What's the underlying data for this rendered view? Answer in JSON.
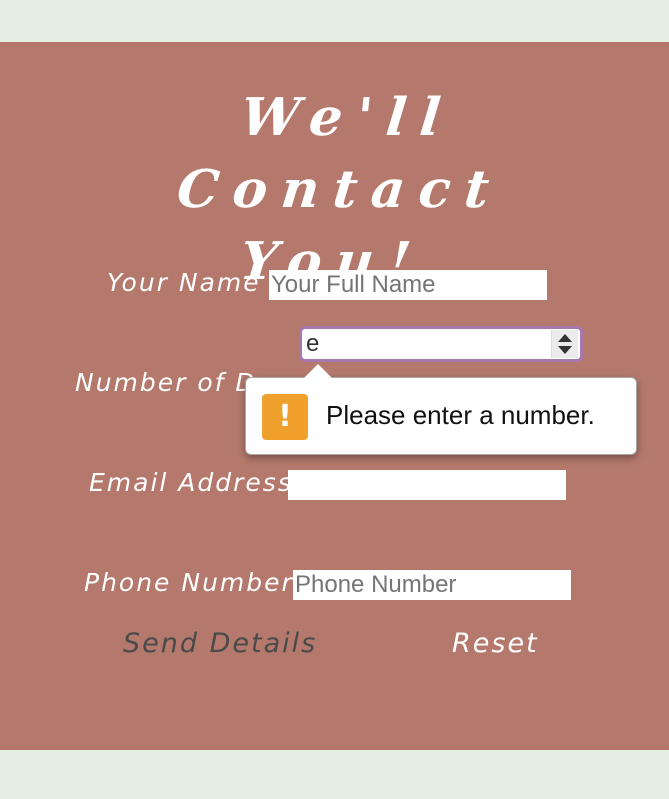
{
  "heading": {
    "line1": "We'll Contact",
    "line2": "You!"
  },
  "form": {
    "name": {
      "label": "Your Name",
      "placeholder": "Your Full Name",
      "value": ""
    },
    "dogs": {
      "label": "Number of Dogs",
      "value": "e"
    },
    "email": {
      "label": "Email Address",
      "placeholder": "",
      "value": ""
    },
    "phone": {
      "label": "Phone Number",
      "placeholder": "Phone Number",
      "value": ""
    }
  },
  "validation": {
    "message": "Please enter a number.",
    "icon": "warning-icon",
    "icon_glyph": "!"
  },
  "buttons": {
    "send_label": "Send Details",
    "reset_label": "Reset"
  },
  "colors": {
    "page_background": "#e3efe3",
    "card_background": "#b4796c",
    "focus_ring": "#a678ae",
    "warning": "#f0a02c"
  }
}
